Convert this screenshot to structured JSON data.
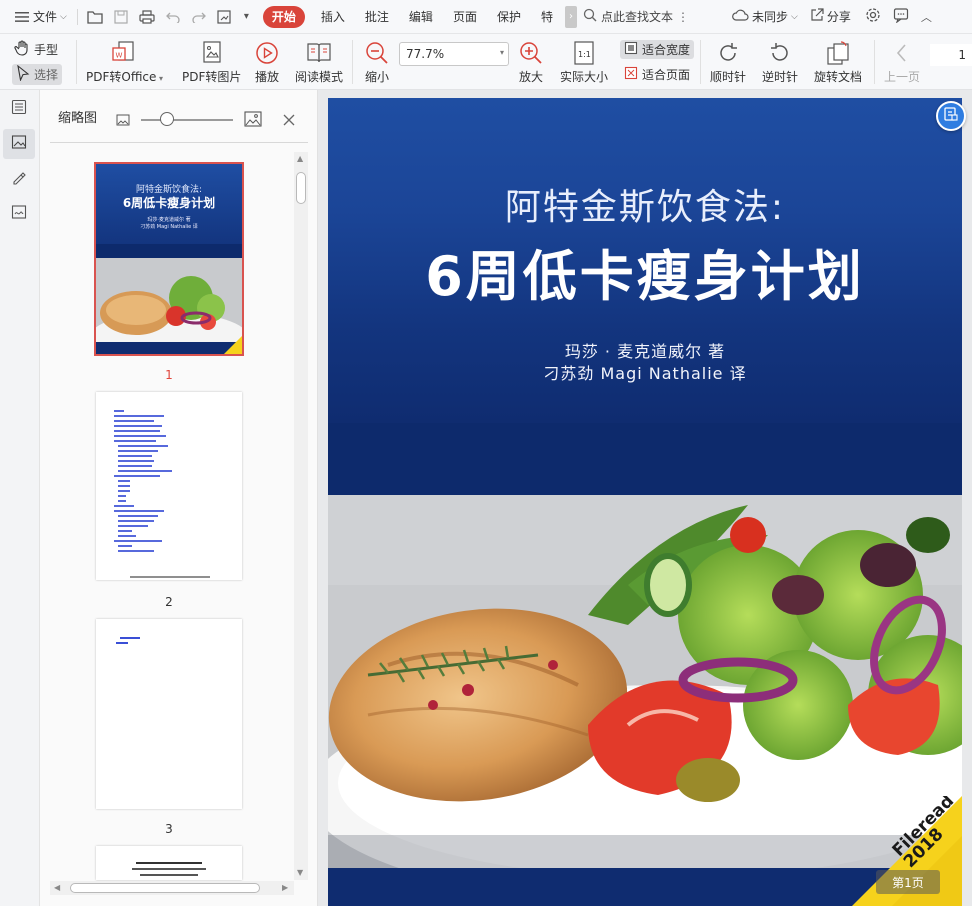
{
  "menubar": {
    "file_label": "文件",
    "tabs": [
      "开始",
      "插入",
      "批注",
      "编辑",
      "页面",
      "保护",
      "特色"
    ],
    "active_tab": "开始",
    "search_placeholder": "点此查找文本",
    "sync_label": "未同步",
    "share_label": "分享"
  },
  "ribbon": {
    "hand_label": "手型",
    "select_label": "选择",
    "pdf_to_office": "PDF转Office",
    "pdf_to_image": "PDF转图片",
    "play": "播放",
    "reading_mode": "阅读模式",
    "zoom_out": "缩小",
    "zoom_value": "77.7%",
    "zoom_in": "放大",
    "actual_size": "实际大小",
    "fit_width": "适合宽度",
    "fit_page": "适合页面",
    "rotate_cw": "顺时针",
    "rotate_ccw": "逆时针",
    "rotate_doc": "旋转文档",
    "prev_page": "上一页",
    "page_number": "1"
  },
  "thumbnail_panel": {
    "title": "缩略图",
    "pages": [
      {
        "number": "1",
        "selected": true
      },
      {
        "number": "2",
        "selected": false
      },
      {
        "number": "3",
        "selected": false
      }
    ],
    "thumb1_title1": "阿特金斯饮食法:",
    "thumb1_title2": "6周低卡瘦身计划",
    "thumb1_author": "玛莎·麦克道威尔 著",
    "thumb1_translator": "刁苏劲 Magi Nathalie 译"
  },
  "document": {
    "title_line1": "阿特金斯饮食法:",
    "title_line2": "6周低卡瘦身计划",
    "author": "玛莎 · 麦克道威尔 著",
    "translator": "刁苏劲 Magi Nathalie 译",
    "corner_tag": "Fileread 2018",
    "page_indicator": "第1页"
  },
  "colors": {
    "accent_red": "#d9443a",
    "cover_blue": "#1b4597",
    "cover_dark_blue": "#0d2a6c",
    "selection_outline": "#d9534f"
  }
}
